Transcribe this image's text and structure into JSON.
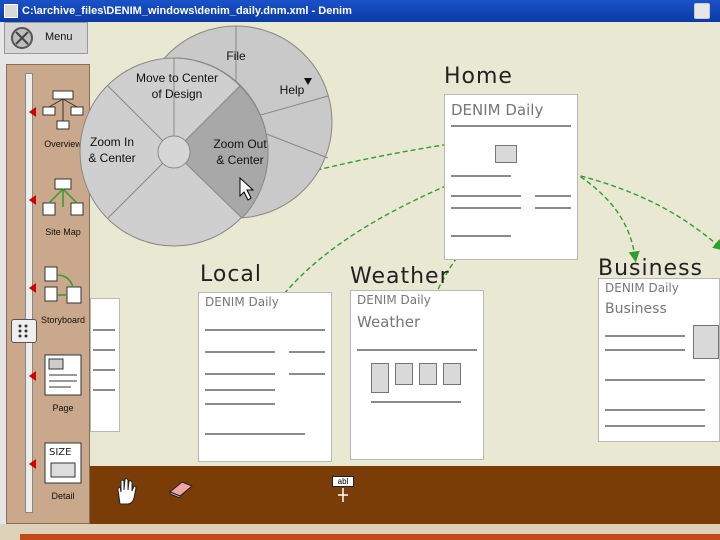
{
  "window": {
    "title": "C:\\archive_files\\DENIM_windows\\denim_daily.dnm.xml - Denim"
  },
  "menu_button": {
    "label": "Menu"
  },
  "zoom_levels": [
    {
      "label": "Overview"
    },
    {
      "label": "Site Map"
    },
    {
      "label": "Storyboard"
    },
    {
      "label": "Page"
    },
    {
      "label": "Detail"
    }
  ],
  "pie_menu": {
    "outer": {
      "file": "File",
      "help": "Help"
    },
    "inner": {
      "move_center": "Move to Center\nof Design",
      "zoom_in": "Zoom In\n& Center",
      "zoom_out": "Zoom Out\n& Center"
    }
  },
  "pages": {
    "home": {
      "label": "Home",
      "sketch_title": "DENIM Daily"
    },
    "local": {
      "label": "Local",
      "sketch_title": "DENIM Daily"
    },
    "weather": {
      "label": "Weather",
      "sketch_title": "DENIM Daily",
      "sub": "Weather"
    },
    "business": {
      "label": "Business",
      "sketch_title": "DENIM Daily",
      "sub": "Business"
    }
  },
  "toolbar": {
    "text_tool": "abl"
  },
  "colors": {
    "arrow": "#2e9e2e",
    "toolbar": "#7a3d07",
    "zoom_strip": "#caa88c"
  }
}
